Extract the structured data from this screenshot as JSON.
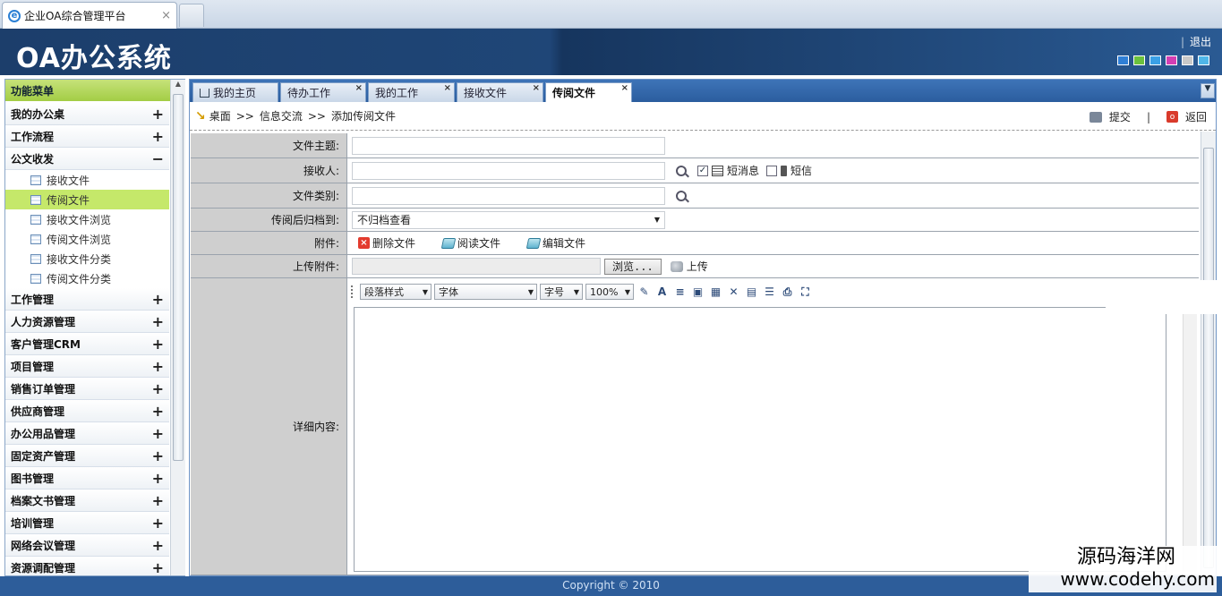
{
  "browser": {
    "tab_title": "企业OA综合管理平台",
    "tab_close": "×"
  },
  "header": {
    "logo": "OA办公系统",
    "logout": "退出",
    "skin_colors": [
      "#2f7fd6",
      "#6bc13d",
      "#3aa0e6",
      "#d23fb3",
      "#c9c9c9",
      "#4fb6e8"
    ]
  },
  "sidebar": {
    "title": "功能菜单",
    "collapse_icon": "«",
    "groups_before": [
      {
        "label": "我的办公桌",
        "toggle": "+"
      },
      {
        "label": "工作流程",
        "toggle": "+"
      }
    ],
    "open_group": {
      "label": "公文收发",
      "toggle": "−"
    },
    "sub_items": [
      "接收文件",
      "传阅文件",
      "接收文件浏览",
      "传阅文件浏览",
      "接收文件分类",
      "传阅文件分类"
    ],
    "groups_after": [
      {
        "label": "工作管理",
        "toggle": "+"
      },
      {
        "label": "人力资源管理",
        "toggle": "+"
      },
      {
        "label": "客户管理CRM",
        "toggle": "+"
      },
      {
        "label": "项目管理",
        "toggle": "+"
      },
      {
        "label": "销售订单管理",
        "toggle": "+"
      },
      {
        "label": "供应商管理",
        "toggle": "+"
      },
      {
        "label": "办公用品管理",
        "toggle": "+"
      },
      {
        "label": "固定资产管理",
        "toggle": "+"
      },
      {
        "label": "图书管理",
        "toggle": "+"
      },
      {
        "label": "档案文书管理",
        "toggle": "+"
      },
      {
        "label": "培训管理",
        "toggle": "+"
      },
      {
        "label": "网络会议管理",
        "toggle": "+"
      },
      {
        "label": "资源调配管理",
        "toggle": "+"
      }
    ]
  },
  "tabs": [
    {
      "label": "我的主页",
      "closable": false
    },
    {
      "label": "待办工作",
      "closable": true
    },
    {
      "label": "我的工作",
      "closable": true
    },
    {
      "label": "接收文件",
      "closable": true
    },
    {
      "label": "传阅文件",
      "closable": true,
      "active": true
    }
  ],
  "tab_close": "×",
  "tab_more": "▼",
  "breadcrumb": {
    "home": "桌面",
    "sep": ">>",
    "level1": "信息交流",
    "level2": "添加传阅文件"
  },
  "actions": {
    "submit": "提交",
    "back": "返回"
  },
  "form": {
    "subject_label": "文件主题:",
    "receiver_label": "接收人:",
    "sms_short_msg": "短消息",
    "sms_sms": "短信",
    "category_label": "文件类别:",
    "archive_label": "传阅后归档到:",
    "archive_value": "不归档查看",
    "attachment_label": "附件:",
    "att_delete": "删除文件",
    "att_read": "阅读文件",
    "att_edit": "编辑文件",
    "upload_label": "上传附件:",
    "browse_btn": "浏览...",
    "upload_btn": "上传",
    "detail_label": "详细内容:"
  },
  "editor": {
    "style": "段落样式",
    "font": "字体",
    "size": "字号",
    "zoom": "100%"
  },
  "footer": {
    "copyright": "Copyright © 2010"
  },
  "watermark": {
    "cn": "源码海洋网",
    "url": "www.codehy.com"
  }
}
